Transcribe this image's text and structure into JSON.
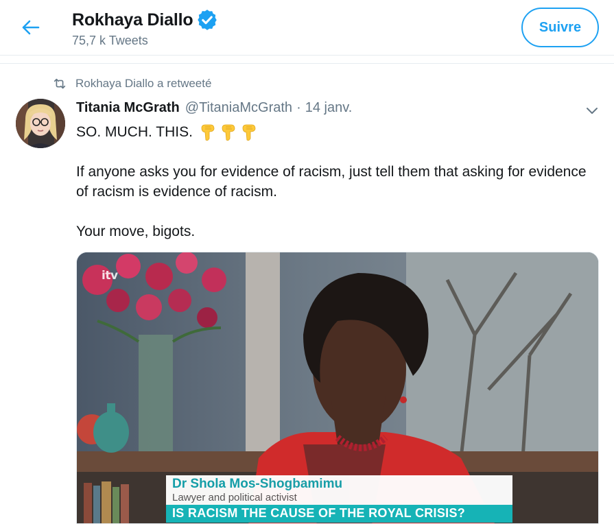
{
  "header": {
    "back_icon": "arrow-left-icon",
    "profile_name": "Rokhaya Diallo",
    "verified_icon": "verified-badge-icon",
    "tweet_count": "75,7 k Tweets",
    "follow_label": "Suivre"
  },
  "tweet": {
    "retweet_icon": "retweet-icon",
    "retweet_label": "Rokhaya Diallo a retweeté",
    "author_name": "Titania McGrath",
    "author_handle": "@TitaniaMcGrath",
    "separator": "·",
    "date": "14 janv.",
    "caret_icon": "chevron-down-icon",
    "body_line1": "SO. MUCH. THIS.",
    "emoji": [
      "👇",
      "👇",
      "👇"
    ],
    "body_para2": "If anyone asks you for evidence of racism, just tell them that asking for evidence of racism is evidence of racism.",
    "body_para3": "Your move, bigots."
  },
  "media": {
    "channel_logo": "itv",
    "chyron_name": "Dr Shola Mos-Shogbamimu",
    "chyron_role": "Lawyer and political activist",
    "chyron_headline": "IS RACISM THE CAUSE OF THE ROYAL CRISIS?"
  },
  "colors": {
    "accent": "#1da1f2",
    "secondary_text": "#657786",
    "chyron_teal": "#16b3b6"
  }
}
